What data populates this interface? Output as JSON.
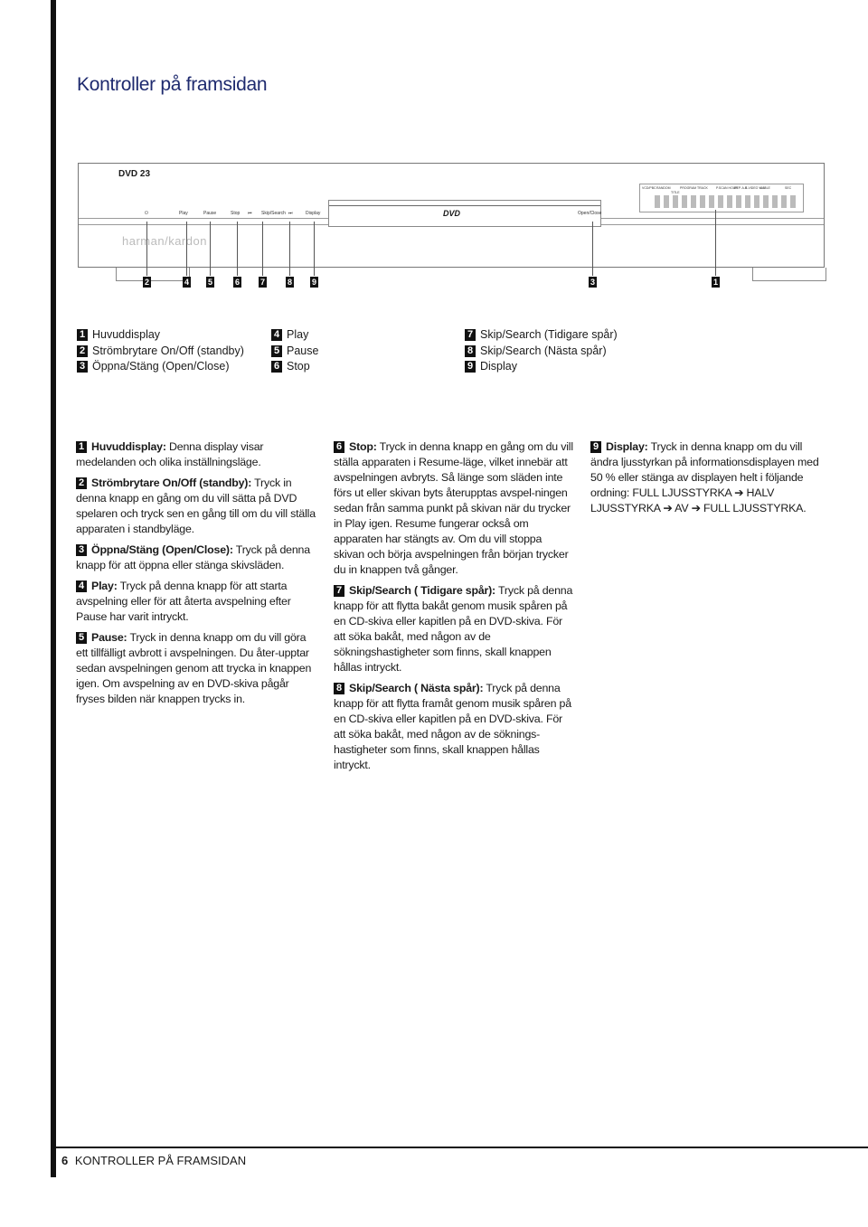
{
  "page_title": "Kontroller på framsidan",
  "device": {
    "model": "DVD 23",
    "brand": "harman/kardon",
    "disc_logo": "DVD",
    "button_labels": [
      "Play",
      "Pause",
      "Stop",
      "Skip/Search",
      "Display",
      "Open/Close"
    ],
    "display_labels": [
      "VCD/PBC",
      "RANDOM",
      "TITLE",
      "PROGRAM TRACK",
      "P.SCAN HOUR",
      "REP. A-B",
      "S-VIDEO Y.UV",
      "ANGLE",
      "SEC"
    ],
    "callouts": [
      "2",
      "4",
      "5",
      "6",
      "7",
      "8",
      "9",
      "3",
      "1"
    ]
  },
  "legend": [
    {
      "num": "1",
      "label": "Huvuddisplay"
    },
    {
      "num": "2",
      "label": "Strömbrytare On/Off (standby)"
    },
    {
      "num": "3",
      "label": "Öppna/Stäng (Open/Close)"
    },
    {
      "num": "4",
      "label": "Play"
    },
    {
      "num": "5",
      "label": "Pause"
    },
    {
      "num": "6",
      "label": "Stop"
    },
    {
      "num": "7",
      "label": "Skip/Search (Tidigare spår)"
    },
    {
      "num": "8",
      "label": "Skip/Search (Nästa spår)"
    },
    {
      "num": "9",
      "label": "Display"
    }
  ],
  "descriptions": [
    {
      "num": "1",
      "term": "Huvuddisplay:",
      "text": " Denna display visar medelanden och olika inställningsläge."
    },
    {
      "num": "2",
      "term": "Strömbrytare On/Off (standby):",
      "text": " Tryck in denna knapp en gång om du vill sätta på DVD spelaren och tryck sen en gång till om du vill ställa apparaten i standbyläge."
    },
    {
      "num": "3",
      "term": "Öppna/Stäng (Open/Close):",
      "text": " Tryck på denna knapp för att öppna eller stänga skivsläden."
    },
    {
      "num": "4",
      "term": "Play:",
      "text": " Tryck på denna knapp för att starta avspelning eller för att återta avspelning efter Pause har varit intryckt."
    },
    {
      "num": "5",
      "term": "Pause:",
      "text": " Tryck in denna knapp om du vill göra ett tillfälligt avbrott i avspelningen. Du åter-upptar sedan avspelningen genom att trycka in knappen igen. Om avspelning av en DVD-skiva pågår fryses bilden när knappen trycks in."
    },
    {
      "num": "6",
      "term": "Stop:",
      "text": " Tryck in denna knapp en gång om du vill ställa apparaten i Resume-läge, vilket innebär att avspelningen avbryts. Så länge som släden inte förs ut eller skivan byts återupptas avspel-ningen sedan från samma punkt på skivan när du trycker in Play igen. Resume fungerar också om apparaten har stängts av. Om du vill stoppa skivan och börja avspelningen från början trycker du in knappen två gånger."
    },
    {
      "num": "7",
      "term": "Skip/Search ( Tidigare spår):",
      "text": " Tryck på denna knapp för att flytta bakåt genom musik spåren på en CD-skiva eller kapitlen på en DVD-skiva. För att söka bakåt, med någon av de sökningshastigheter som finns, skall knappen hållas intryckt."
    },
    {
      "num": "8",
      "term": "Skip/Search ( Nästa spår):",
      "text": " Tryck på denna knapp för att flytta framåt genom musik spåren på en CD-skiva eller kapitlen på en DVD-skiva. För att söka bakåt, med någon av de söknings-hastigheter som finns, skall knappen hållas intryckt."
    },
    {
      "num": "9",
      "term": "Display:",
      "text": " Tryck in denna knapp om du vill ändra ljusstyrkan på informationsdisplayen med 50 % eller stänga av displayen helt i följande ordning: FULL LJUSSTYRKA ➔ HALV LJUSSTYRKA ➔ AV ➔ FULL LJUSSTYRKA."
    }
  ],
  "footer": {
    "page_number": "6",
    "section": "KONTROLLER PÅ FRAMSIDAN"
  }
}
